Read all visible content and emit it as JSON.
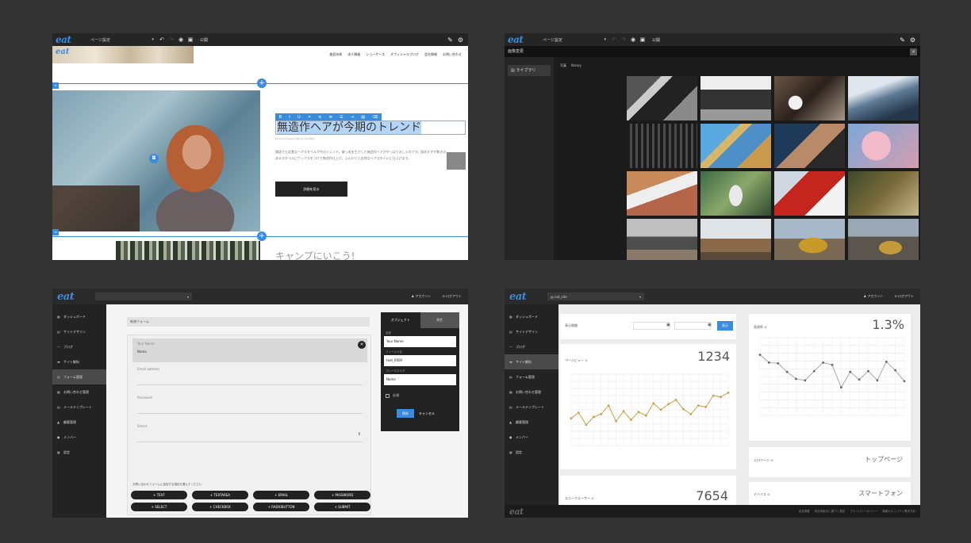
{
  "colors": {
    "accent": "#3a8dde",
    "dark": "#222222",
    "background": "#333333"
  },
  "editor": {
    "logo": "eat",
    "page_select": "ページ設定",
    "publish": "公開",
    "nav": [
      "美容技術",
      "求人情報",
      "ショーケース",
      "オフィシャルブログ",
      "会社情報",
      "お問い合わせ"
    ],
    "headline_plain": "",
    "headline_selected": "無造作ヘアが今期のトレンド",
    "subcaption": "Source of layout site for the field",
    "body": "雑誌でも定番なヘアスタイルが今のトレンド。癖っ毛を生かした無造作ヘアがやっぱりおしゃれです。固めすぎず動きのあるスタイルにワックスをつけて無造作仕上げ。ふんわりと自然なヘアスタイルに仕上げます。",
    "side_tab": "",
    "button": "詳細を見る",
    "camp": "キャンプにいこう!"
  },
  "image_modal": {
    "title": "画像変更",
    "close": "×",
    "sidebar_item": "ライブラリ",
    "tabs": [
      "写真",
      "library"
    ]
  },
  "admin": {
    "logo": "eat",
    "account": "アカウント",
    "logout": "ログアウト",
    "sidebar": [
      {
        "icon": "▦",
        "label": "ダッシュボード"
      },
      {
        "icon": "▤",
        "label": "サイトデザイン"
      },
      {
        "icon": "〰",
        "label": "ブログ"
      },
      {
        "icon": "▬",
        "label": "サイト解析"
      },
      {
        "icon": "▤",
        "label": "フォーム管理"
      },
      {
        "icon": "▦",
        "label": "お問い合わせ管理"
      },
      {
        "icon": "▤",
        "label": "メールテンプレート"
      },
      {
        "icon": "▲",
        "label": "顧客管理"
      },
      {
        "icon": "●",
        "label": "メンバー"
      },
      {
        "icon": "▦",
        "label": "設定"
      }
    ]
  },
  "form_builder": {
    "site_select": "",
    "form_name": "新規フォーム",
    "fields": [
      {
        "label": "Your Name",
        "value": "Name"
      },
      {
        "label": "Email address",
        "value": ""
      },
      {
        "label": "Password",
        "value": ""
      },
      {
        "label": "Select",
        "value": ""
      }
    ],
    "add_caption": "お問い合わせフォームに追加する項目を選んでください",
    "field_buttons": [
      "TEXT",
      "TEXTAREA",
      "EMAIL",
      "PASSWORD",
      "SELECT",
      "CHECKBOX",
      "RADIOBUTTON",
      "SUBMIT"
    ],
    "prop_tabs": [
      "オブジェクト",
      "属性"
    ],
    "prop_labels": [
      "名前",
      "フィールド名",
      "プレースホルダ"
    ],
    "prop_values": [
      "Your Name",
      "text_0000",
      "Name"
    ],
    "required": "必須",
    "save": "保存",
    "cancel": "キャンセル"
  },
  "analytics": {
    "site_select": "eat_site",
    "period_label": "表示期間",
    "date_from": "",
    "date_to": "",
    "show": "表示",
    "pageview_label": "ページビュー",
    "pageview_value": "1234",
    "unique_label": "ユニークユーザー",
    "unique_value": "7654",
    "bounce_label": "直帰率",
    "bounce_value": "1.3%",
    "entry_label": "入口ページ",
    "entry_value": "トップページ",
    "device_label": "デバイス",
    "device_value": "スマートフォン",
    "footer_links": [
      "会社概要",
      "特定商取引に基づく表記",
      "プライバシーポリシー",
      "情報セキュリティ基本方針"
    ]
  },
  "chart_data": [
    {
      "type": "line",
      "title": "ページビュー",
      "ylim": [
        0,
        1
      ],
      "values": [
        0.38,
        0.46,
        0.29,
        0.4,
        0.44,
        0.56,
        0.34,
        0.48,
        0.36,
        0.47,
        0.42,
        0.59,
        0.5,
        0.58,
        0.64,
        0.51,
        0.44,
        0.56,
        0.54,
        0.7,
        0.68,
        0.74
      ]
    },
    {
      "type": "line",
      "title": "直帰率",
      "ylim": [
        0,
        1
      ],
      "values": [
        0.78,
        0.68,
        0.67,
        0.56,
        0.47,
        0.45,
        0.57,
        0.68,
        0.65,
        0.36,
        0.56,
        0.46,
        0.57,
        0.45,
        0.69,
        0.58,
        0.44
      ]
    }
  ]
}
